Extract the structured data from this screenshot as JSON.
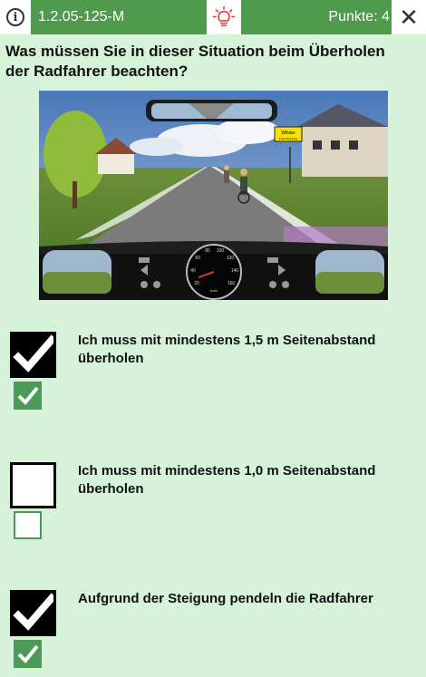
{
  "header": {
    "question_id": "1.2.05-125-M",
    "points_label": "Punkte: 4",
    "info_icon": "info-icon",
    "hint_icon": "lightbulb-icon",
    "close_icon": "close-icon"
  },
  "question": {
    "text": "Was müssen Sie in dieser Situation beim Überholen der Radfahrer beachten?"
  },
  "image": {
    "sign_text": "Wilster",
    "sign_subtext": "Kreis Steinburg",
    "speedo_unit": "km/h",
    "speedo_ticks": [
      "20",
      "40",
      "60",
      "80",
      "100",
      "120",
      "140",
      "160"
    ]
  },
  "answers": [
    {
      "text": "Ich muss mit mindestens 1,5 m Seitenabstand überholen",
      "selected": true,
      "correct": true
    },
    {
      "text": "Ich muss mit mindestens 1,0 m Seitenabstand überholen",
      "selected": false,
      "correct": false
    },
    {
      "text": "Aufgrund der Steigung pendeln die Radfahrer",
      "selected": true,
      "correct": true
    }
  ],
  "colors": {
    "header_green": "#4f9a4d",
    "background": "#d6f2d8",
    "correct_green": "#4c9a58",
    "hint_red": "#e53935"
  }
}
